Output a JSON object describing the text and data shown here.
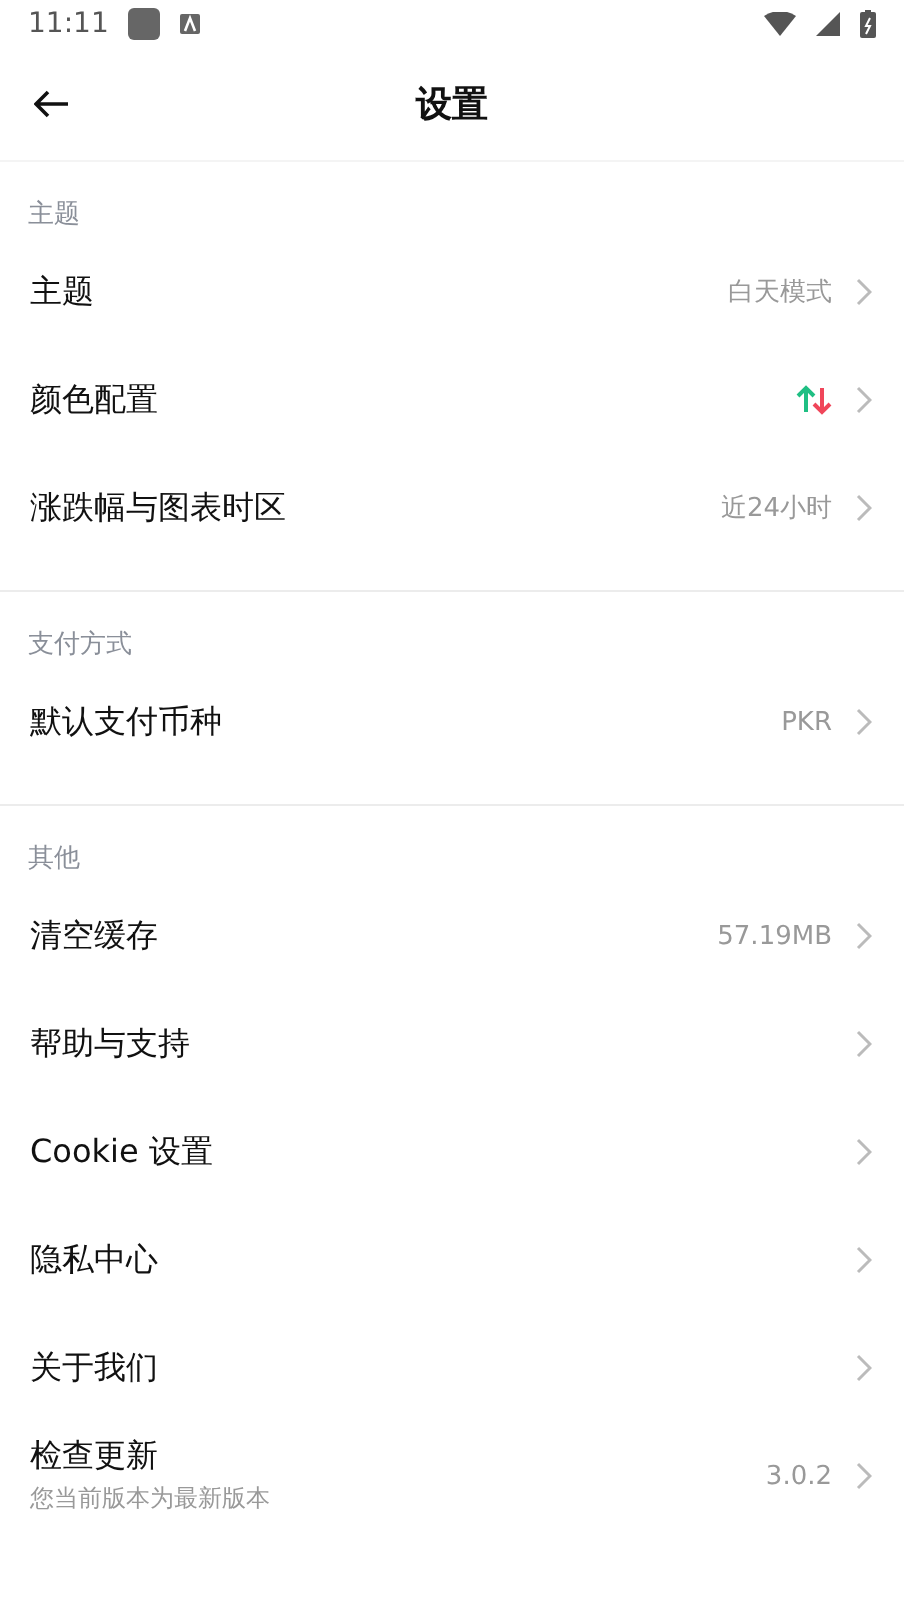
{
  "status_bar": {
    "time": "11:11"
  },
  "header": {
    "title": "设置"
  },
  "sections": [
    {
      "title": "主题",
      "items": [
        {
          "label": "主题",
          "kind": "text",
          "value": "白天模式"
        },
        {
          "label": "颜色配置",
          "kind": "arrows",
          "arrows": [
            {
              "kind": "up",
              "color": "#1fbf83"
            },
            {
              "kind": "down",
              "color": "#f0465a"
            }
          ]
        },
        {
          "label": "涨跌幅与图表时区",
          "kind": "text",
          "value": "近24小时"
        }
      ]
    },
    {
      "title": "支付方式",
      "items": [
        {
          "label": "默认支付币种",
          "kind": "text",
          "value": "PKR"
        }
      ]
    },
    {
      "title": "其他",
      "items": [
        {
          "label": "清空缓存",
          "kind": "text",
          "value": "57.19MB"
        },
        {
          "label": "帮助与支持",
          "kind": "plain"
        },
        {
          "label": "Cookie 设置",
          "kind": "plain"
        },
        {
          "label": "隐私中心",
          "kind": "plain"
        },
        {
          "label": "关于我们",
          "kind": "plain"
        },
        {
          "label": "检查更新",
          "kind": "text",
          "value": "3.0.2",
          "subtitle": "您当前版本为最新版本"
        }
      ]
    }
  ]
}
